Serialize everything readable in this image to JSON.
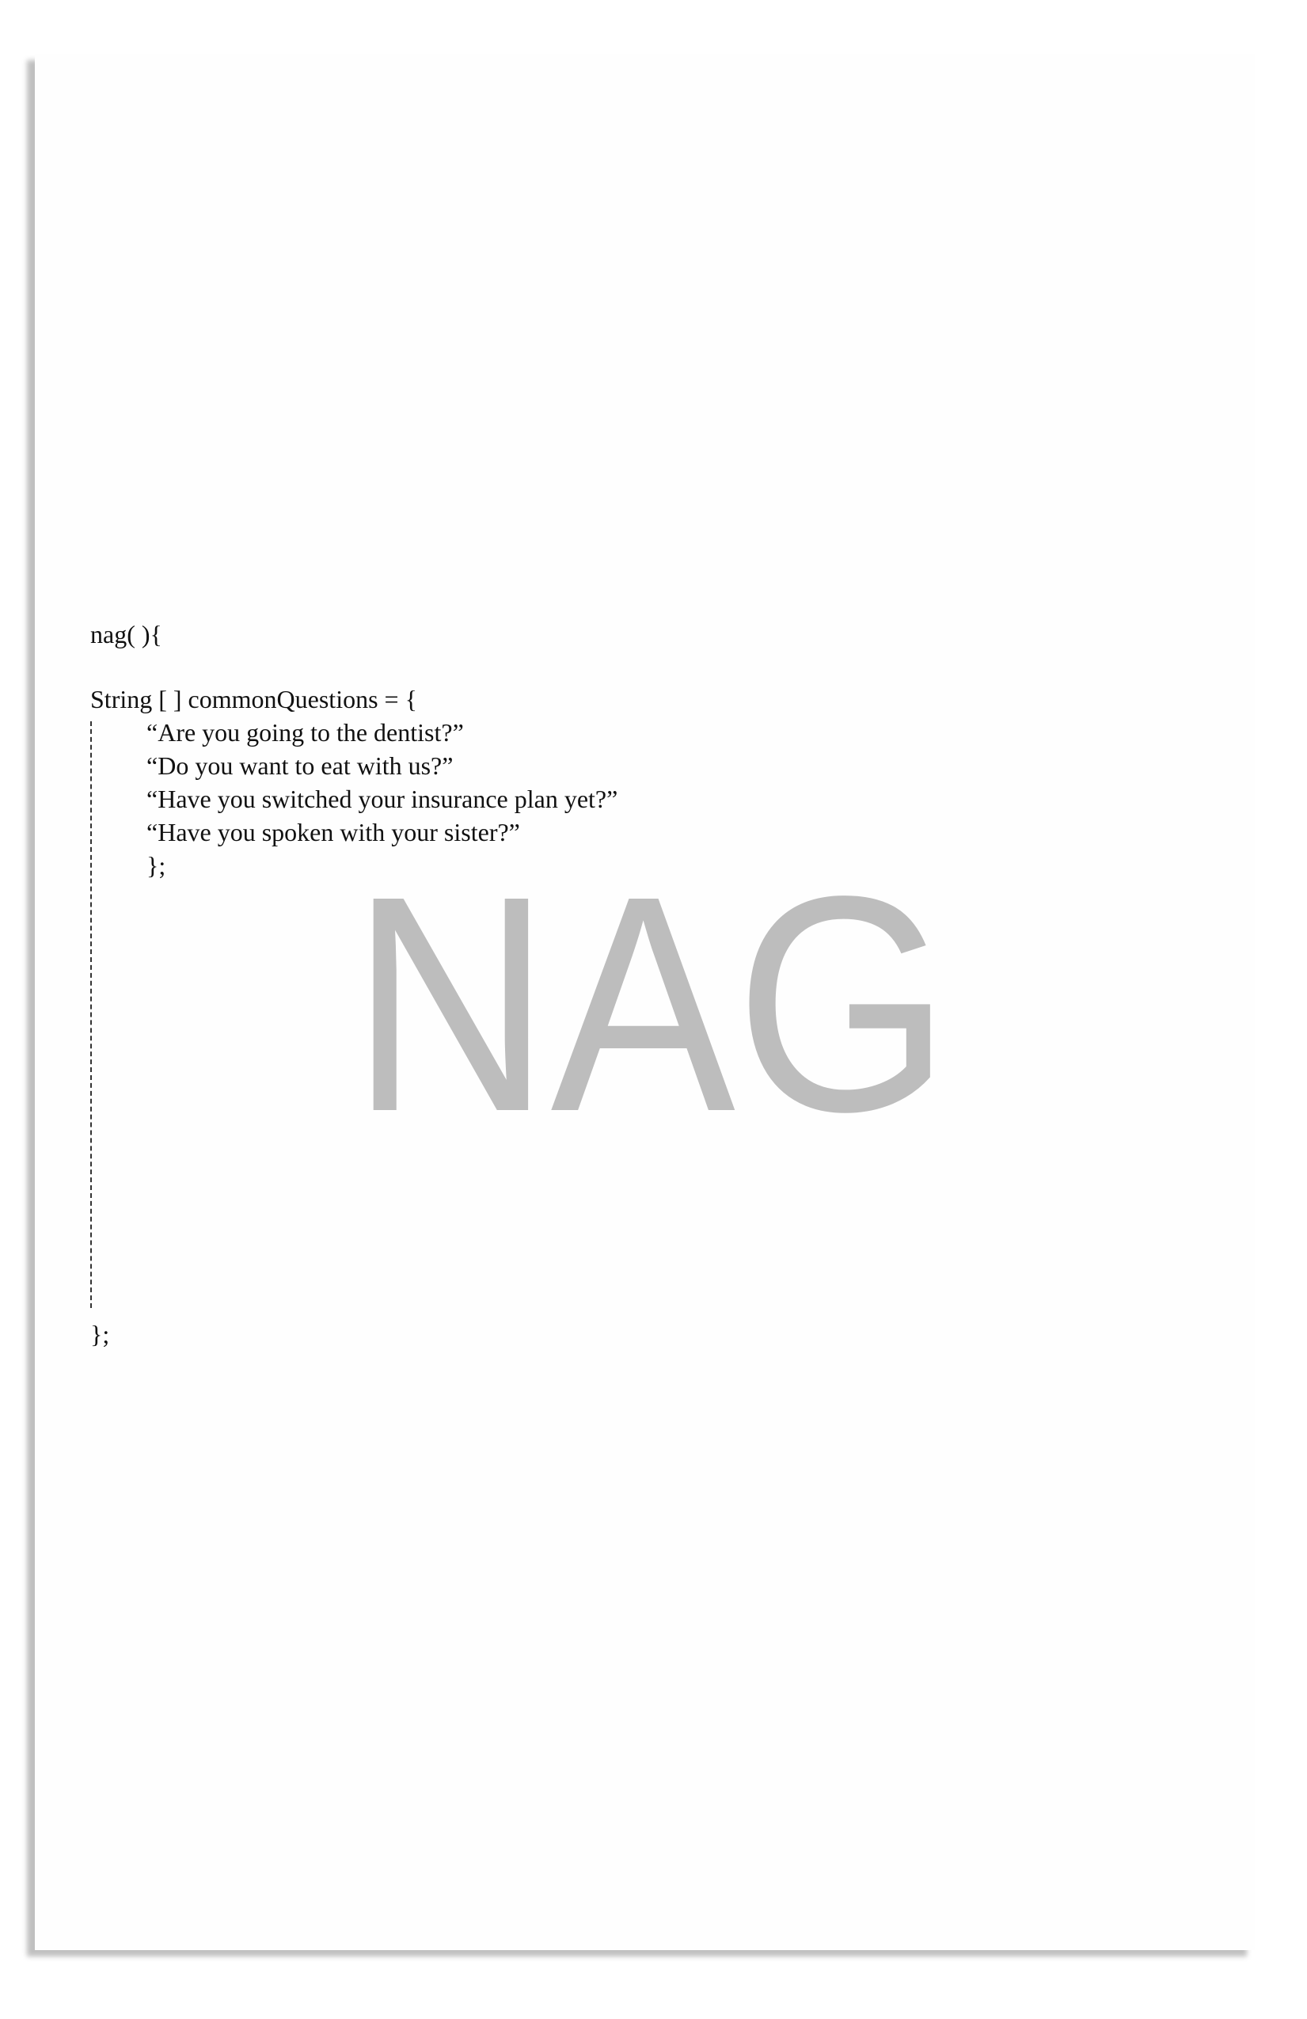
{
  "code": {
    "function_open": "nag( ){",
    "array_decl": "String [ ] commonQuestions = {",
    "questions": [
      "“Are you going to the dentist?”",
      "“Do you want to eat with us?”",
      "“Have you switched your insurance plan yet?”",
      "“Have you spoken with your sister?”"
    ],
    "array_close": "};",
    "function_close": "};"
  },
  "title": {
    "text": "NAG",
    "color": "#bdbdbd"
  }
}
